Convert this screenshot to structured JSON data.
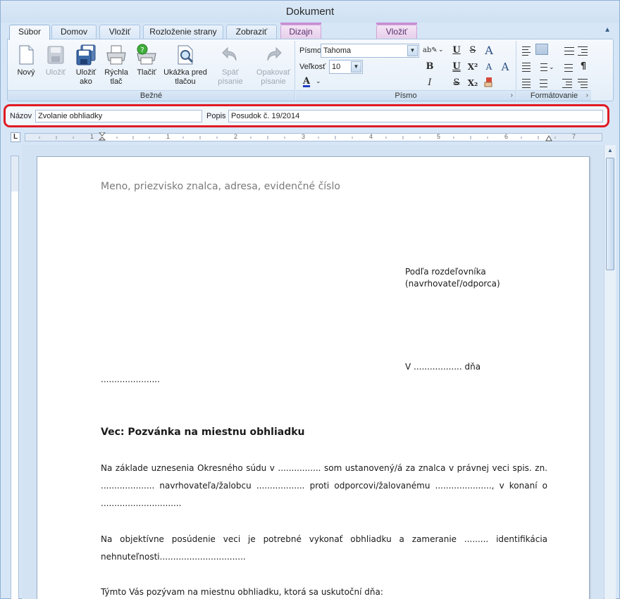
{
  "window": {
    "title": "Dokument"
  },
  "tabs": [
    {
      "label": "Súbor",
      "active": true
    },
    {
      "label": "Domov"
    },
    {
      "label": "Vložiť"
    },
    {
      "label": "Rozloženie strany"
    },
    {
      "label": "Zobraziť"
    },
    {
      "label": "Dizajn",
      "contextual": true
    },
    {
      "label": "Vložiť",
      "contextual": true
    }
  ],
  "ribbon": {
    "common": {
      "label": "Bežné",
      "buttons": {
        "new": "Nový",
        "save": "Uložiť",
        "save_as": "Uložiť ako",
        "quick_print": "Rýchla tlač",
        "print": "Tlačiť",
        "print_preview": "Ukážka pred tlačou",
        "undo": "Späť písanie",
        "redo": "Opakovať písanie"
      }
    },
    "font": {
      "label": "Písmo",
      "font_label": "Písmo",
      "font_value": "Tahoma",
      "size_label": "Veľkosť",
      "size_value": "10",
      "glyphs": {
        "bold": "B",
        "italic": "I",
        "underline": "U",
        "strike": "S",
        "superscript": "X²",
        "subscript": "X₂",
        "grow": "A",
        "color": "A"
      }
    },
    "formatting": {
      "label": "Formátovanie",
      "pilcrow": "¶"
    }
  },
  "meta": {
    "name_label": "Názov",
    "name_value": "Zvolanie obhliadky",
    "desc_label": "Popis",
    "desc_value": "Posudok č. 19/2014"
  },
  "ruler": {
    "corner": "L",
    "numbers": [
      "1",
      "1",
      "2",
      "3",
      "4",
      "5",
      "6",
      "7"
    ]
  },
  "document": {
    "sender": "Meno, priezvisko znalca, adresa, evidenčné číslo",
    "recipient_line1": "Podľa rozdeľovníka",
    "recipient_line2": "(navrhovateľ/odporca)",
    "place_date": "V .................. dňa",
    "date_dots": "......................",
    "subject": "Vec: Pozvánka na miestnu obhliadku",
    "para1": "Na základe uznesenia Okresného súdu v ................ som ustanovený/á za znalca v právnej veci spis. zn. .................... navrhovateľa/žalobcu .................. proti odporcovi/žalovanému ....................., v konaní o ..............................",
    "para2": "Na objektívne posúdenie veci je potrebné vykonať obhliadku a zameranie ......... identifikácia nehnuteľnosti................................",
    "para3": "Týmto Vás pozývam na miestnu obhliadku, ktorá sa uskutoční dňa:"
  },
  "colors": {
    "highlight_border": "#e01b24",
    "contextual_tab": "#c88ed4",
    "font_color_bar": "#1f3fbf"
  }
}
